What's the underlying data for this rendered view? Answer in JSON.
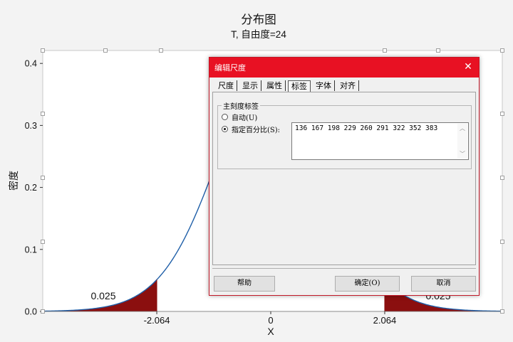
{
  "chart_data": {
    "type": "area",
    "title": "分布图",
    "subtitle": "T, 自由度=24",
    "xlabel": "X",
    "ylabel": "密度",
    "ylim": [
      0,
      0.42
    ],
    "y_ticks": [
      "0.0",
      "0.1",
      "0.2",
      "0.3",
      "0.4"
    ],
    "x_ticks": [
      "-2.064",
      "0",
      "2.064"
    ],
    "critical_values": [
      -2.064,
      2.064
    ],
    "tail_labels": [
      "0.025",
      "0.025"
    ],
    "degrees_of_freedom": 24,
    "colors": {
      "curve": "#1f5fa8",
      "shade": "#8b0f0f"
    }
  },
  "dialog": {
    "title": "编辑尺度",
    "close_glyph": "✕",
    "tabs": [
      "尺度",
      "显示",
      "属性",
      "标签",
      "字体",
      "对齐"
    ],
    "active_tab": "标签",
    "group_label": "主刻度标签",
    "option_auto": "自动(U)",
    "option_pct": "指定百分比(S):",
    "pct_value": "136 167 198 229 260 291 322 352 383",
    "buttons": {
      "help": "帮助",
      "ok": "确定(O)",
      "cancel": "取消"
    },
    "accent_color": "#e81123"
  }
}
